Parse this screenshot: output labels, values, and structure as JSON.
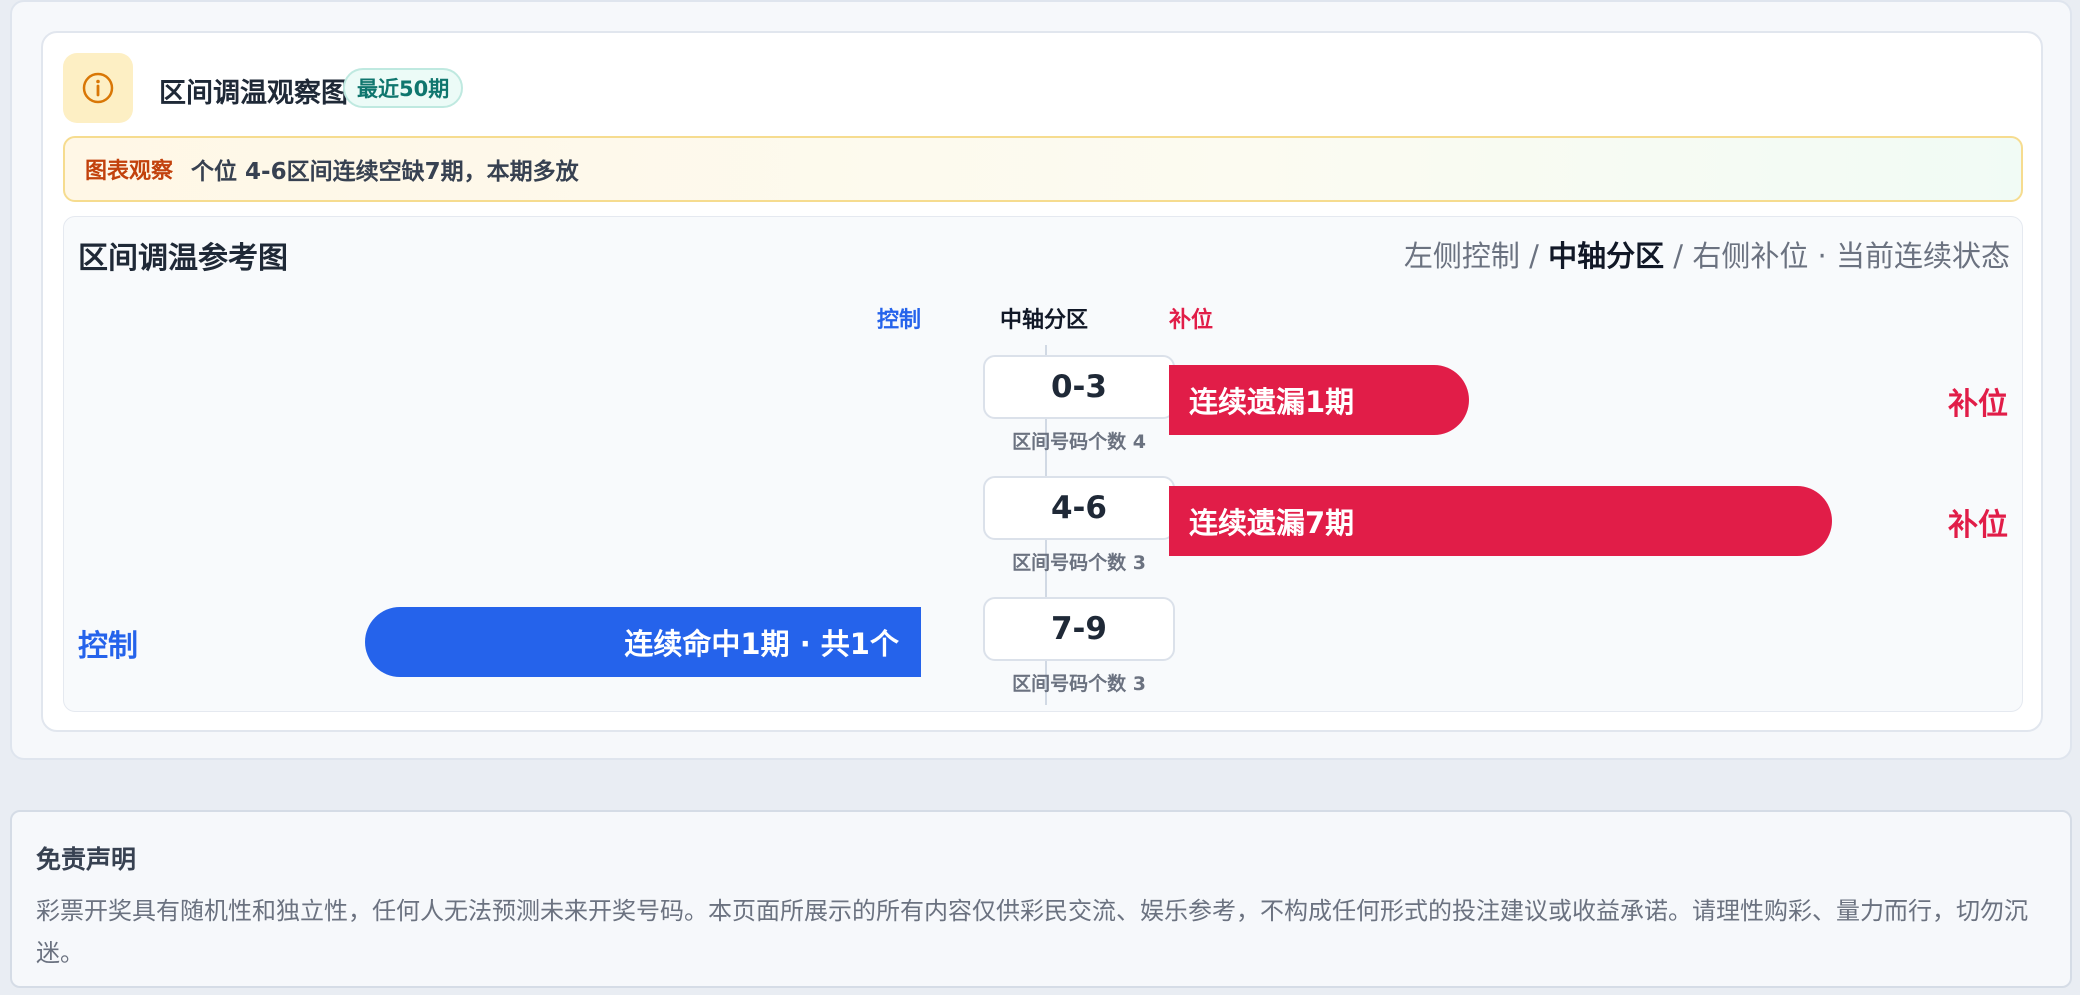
{
  "panel": {
    "title": "区间调温观察图",
    "badge": "最近50期",
    "observation_label": "图表观察",
    "observation_text": "个位 4-6区间连续空缺7期，本期多放"
  },
  "chart": {
    "title": "区间调温参考图",
    "legend_left": "左侧控制",
    "legend_sep1": " / ",
    "legend_mid": "中轴分区",
    "legend_sep2": " / ",
    "legend_right": "右侧补位",
    "legend_dot": " · ",
    "legend_state": "当前连续状态",
    "col_control": "控制",
    "col_axis": "中轴分区",
    "col_fill": "补位"
  },
  "chart_data": {
    "type": "bar",
    "categories": [
      "0-3",
      "4-6",
      "7-9"
    ],
    "rows": [
      {
        "zone": "0-3",
        "count_label": "区间号码个数 4",
        "side": "right",
        "bar_label": "连续遗漏1期",
        "side_tag": "补位",
        "streak": 1
      },
      {
        "zone": "4-6",
        "count_label": "区间号码个数 3",
        "side": "right",
        "bar_label": "连续遗漏7期",
        "side_tag": "补位",
        "streak": 7
      },
      {
        "zone": "7-9",
        "count_label": "区间号码个数 3",
        "side": "left",
        "bar_label": "连续命中1期 · 共1个",
        "side_tag": "控制",
        "streak": 1
      }
    ],
    "colors": {
      "fill": "#e11d48",
      "control": "#2563eb"
    }
  },
  "disclaimer": {
    "title": "免责声明",
    "body": "彩票开奖具有随机性和独立性，任何人无法预测未来开奖号码。本页面所展示的所有内容仅供彩民交流、娱乐参考，不构成任何形式的投注建议或收益承诺。请理性购彩、量力而行，切勿沉迷。"
  }
}
